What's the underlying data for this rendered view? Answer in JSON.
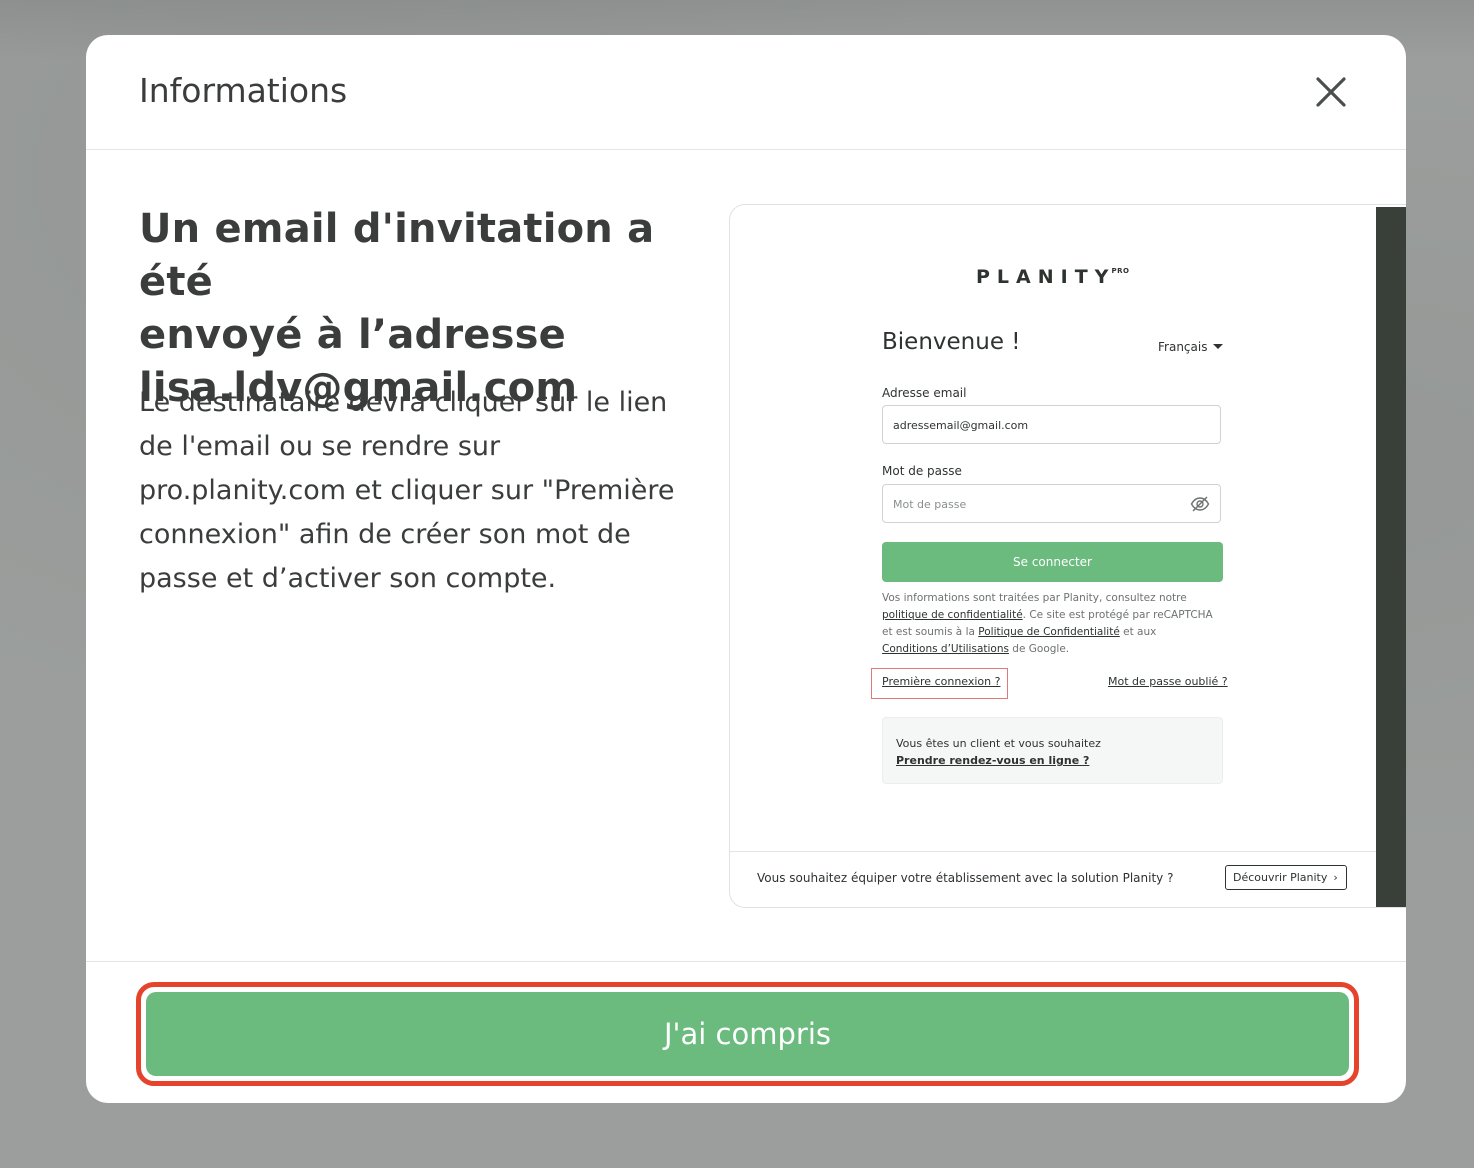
{
  "modal": {
    "title": "Informations",
    "headline_lines": [
      "Un email d'invitation a été",
      "envoyé à l’adresse",
      "lisa.ldv@gmail.com"
    ],
    "description_lines": [
      "Le destinataire devra cliquer sur le lien",
      "de l'email ou se rendre sur",
      "pro.planity.com et cliquer sur \"Première",
      "connexion\" afin de créer son mot de",
      "passe et d’activer son compte."
    ],
    "confirm_label": "J'ai compris"
  },
  "preview": {
    "logo": "PLANITY",
    "logo_suffix": "PRO",
    "welcome": "Bienvenue !",
    "language": "Français",
    "email_label": "Adresse email",
    "email_value": "adressemail@gmail.com",
    "password_label": "Mot de passe",
    "password_placeholder": "Mot de passe",
    "connect_label": "Se connecter",
    "legal": {
      "line1": "Vos informations sont traitées par Planity, consultez notre",
      "privacy_link": "politique de confidentialité",
      "line2_rest": ". Ce site est protégé par reCAPTCHA",
      "line3_start": "et est soumis à la ",
      "google_privacy_link": "Politique de Confidentialité",
      "line3_end": " et aux",
      "terms_link": "Conditions d’Utilisations",
      "line4_end": " de Google."
    },
    "first_login": "Première connexion ?",
    "forgot_password": "Mot de passe oublié ?",
    "client_text": "Vous êtes un client et vous souhaitez",
    "client_link": "Prendre rendez-vous en ligne ?",
    "footer_text": "Vous souhaitez équiper votre établissement avec la solution Planity ?",
    "discover_label": "Découvrir Planity"
  },
  "colors": {
    "accent_green": "#6abb7d",
    "highlight_red": "#e5432c",
    "text_dark": "#3a3d3b"
  }
}
